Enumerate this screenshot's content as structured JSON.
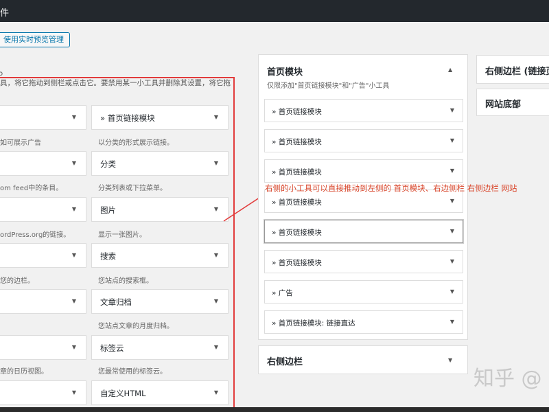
{
  "topbar": {
    "title": "件"
  },
  "preview_button": "使用实时预览管理",
  "available": {
    "description": "具，将它拖动到侧栏或点击它。要禁用某一小工具并删除其设置，将它拖",
    "marker": "o",
    "widgets": [
      {
        "name": "",
        "desc": "如可展示广告"
      },
      {
        "name": "» 首页链接模块",
        "desc": "以分类的形式展示链接。"
      },
      {
        "name": "",
        "desc": "om feed中的条目。"
      },
      {
        "name": "分类",
        "desc": "分类列表或下拉菜单。"
      },
      {
        "name": "",
        "desc": "ordPress.org的链接。"
      },
      {
        "name": "图片",
        "desc": "显示一张图片。"
      },
      {
        "name": "",
        "desc": "您的边栏。"
      },
      {
        "name": "搜索",
        "desc": "您站点的搜索框。"
      },
      {
        "name": "",
        "desc": ""
      },
      {
        "name": "文章归档",
        "desc": "您站点文章的月度归档。"
      },
      {
        "name": "",
        "desc": "章的日历视图。"
      },
      {
        "name": "标签云",
        "desc": "您最常使用的标签云。"
      },
      {
        "name": "",
        "desc": ""
      },
      {
        "name": "自定义HTML",
        "desc": ""
      }
    ]
  },
  "home_area": {
    "title": "首页模块",
    "description": "仅限添加\"首页链接模块\"和\"广告\"小工具",
    "items": [
      "» 首页链接模块",
      "» 首页链接模块",
      "» 首页链接模块",
      "» 首页链接模块",
      "» 首页链接模块",
      "» 首页链接模块",
      "» 广告",
      "» 首页链接模块: 链接直达"
    ]
  },
  "right_sidebar_area": {
    "title": "右侧边栏"
  },
  "far_right": {
    "sidebar_links_title": "右侧边栏 (链接页",
    "footer_title": "网站底部"
  },
  "annotation": "右侧的小工具可以直接推动到左侧的 首页模块、右边侧栏 右侧边栏 网站",
  "watermark": "知乎 @",
  "colors": {
    "highlight_box": "#e23b3b",
    "annotation_text": "#d9462b",
    "admin_bar": "#23282d",
    "link_blue": "#0073aa"
  }
}
